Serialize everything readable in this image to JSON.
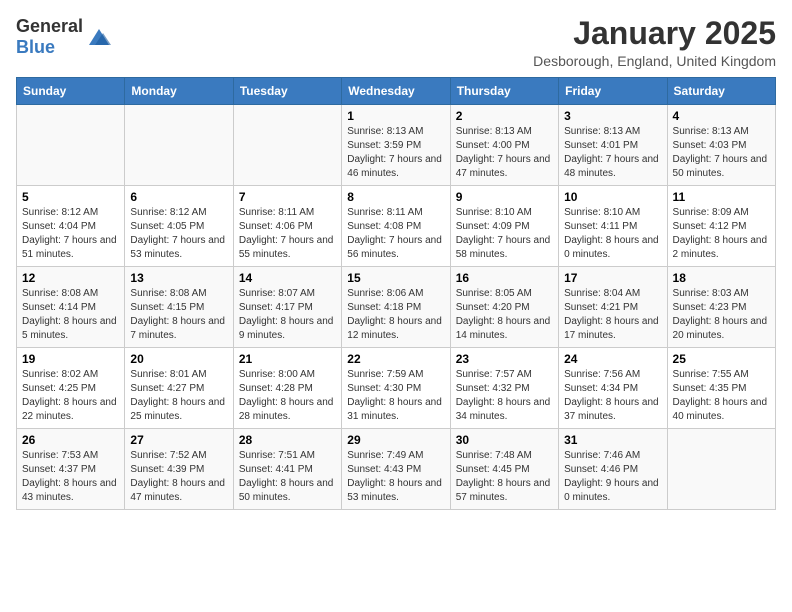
{
  "header": {
    "logo_general": "General",
    "logo_blue": "Blue",
    "title": "January 2025",
    "subtitle": "Desborough, England, United Kingdom"
  },
  "days_of_week": [
    "Sunday",
    "Monday",
    "Tuesday",
    "Wednesday",
    "Thursday",
    "Friday",
    "Saturday"
  ],
  "weeks": [
    [
      {
        "day": "",
        "sunrise": "",
        "sunset": "",
        "daylight": ""
      },
      {
        "day": "",
        "sunrise": "",
        "sunset": "",
        "daylight": ""
      },
      {
        "day": "",
        "sunrise": "",
        "sunset": "",
        "daylight": ""
      },
      {
        "day": "1",
        "sunrise": "Sunrise: 8:13 AM",
        "sunset": "Sunset: 3:59 PM",
        "daylight": "Daylight: 7 hours and 46 minutes."
      },
      {
        "day": "2",
        "sunrise": "Sunrise: 8:13 AM",
        "sunset": "Sunset: 4:00 PM",
        "daylight": "Daylight: 7 hours and 47 minutes."
      },
      {
        "day": "3",
        "sunrise": "Sunrise: 8:13 AM",
        "sunset": "Sunset: 4:01 PM",
        "daylight": "Daylight: 7 hours and 48 minutes."
      },
      {
        "day": "4",
        "sunrise": "Sunrise: 8:13 AM",
        "sunset": "Sunset: 4:03 PM",
        "daylight": "Daylight: 7 hours and 50 minutes."
      }
    ],
    [
      {
        "day": "5",
        "sunrise": "Sunrise: 8:12 AM",
        "sunset": "Sunset: 4:04 PM",
        "daylight": "Daylight: 7 hours and 51 minutes."
      },
      {
        "day": "6",
        "sunrise": "Sunrise: 8:12 AM",
        "sunset": "Sunset: 4:05 PM",
        "daylight": "Daylight: 7 hours and 53 minutes."
      },
      {
        "day": "7",
        "sunrise": "Sunrise: 8:11 AM",
        "sunset": "Sunset: 4:06 PM",
        "daylight": "Daylight: 7 hours and 55 minutes."
      },
      {
        "day": "8",
        "sunrise": "Sunrise: 8:11 AM",
        "sunset": "Sunset: 4:08 PM",
        "daylight": "Daylight: 7 hours and 56 minutes."
      },
      {
        "day": "9",
        "sunrise": "Sunrise: 8:10 AM",
        "sunset": "Sunset: 4:09 PM",
        "daylight": "Daylight: 7 hours and 58 minutes."
      },
      {
        "day": "10",
        "sunrise": "Sunrise: 8:10 AM",
        "sunset": "Sunset: 4:11 PM",
        "daylight": "Daylight: 8 hours and 0 minutes."
      },
      {
        "day": "11",
        "sunrise": "Sunrise: 8:09 AM",
        "sunset": "Sunset: 4:12 PM",
        "daylight": "Daylight: 8 hours and 2 minutes."
      }
    ],
    [
      {
        "day": "12",
        "sunrise": "Sunrise: 8:08 AM",
        "sunset": "Sunset: 4:14 PM",
        "daylight": "Daylight: 8 hours and 5 minutes."
      },
      {
        "day": "13",
        "sunrise": "Sunrise: 8:08 AM",
        "sunset": "Sunset: 4:15 PM",
        "daylight": "Daylight: 8 hours and 7 minutes."
      },
      {
        "day": "14",
        "sunrise": "Sunrise: 8:07 AM",
        "sunset": "Sunset: 4:17 PM",
        "daylight": "Daylight: 8 hours and 9 minutes."
      },
      {
        "day": "15",
        "sunrise": "Sunrise: 8:06 AM",
        "sunset": "Sunset: 4:18 PM",
        "daylight": "Daylight: 8 hours and 12 minutes."
      },
      {
        "day": "16",
        "sunrise": "Sunrise: 8:05 AM",
        "sunset": "Sunset: 4:20 PM",
        "daylight": "Daylight: 8 hours and 14 minutes."
      },
      {
        "day": "17",
        "sunrise": "Sunrise: 8:04 AM",
        "sunset": "Sunset: 4:21 PM",
        "daylight": "Daylight: 8 hours and 17 minutes."
      },
      {
        "day": "18",
        "sunrise": "Sunrise: 8:03 AM",
        "sunset": "Sunset: 4:23 PM",
        "daylight": "Daylight: 8 hours and 20 minutes."
      }
    ],
    [
      {
        "day": "19",
        "sunrise": "Sunrise: 8:02 AM",
        "sunset": "Sunset: 4:25 PM",
        "daylight": "Daylight: 8 hours and 22 minutes."
      },
      {
        "day": "20",
        "sunrise": "Sunrise: 8:01 AM",
        "sunset": "Sunset: 4:27 PM",
        "daylight": "Daylight: 8 hours and 25 minutes."
      },
      {
        "day": "21",
        "sunrise": "Sunrise: 8:00 AM",
        "sunset": "Sunset: 4:28 PM",
        "daylight": "Daylight: 8 hours and 28 minutes."
      },
      {
        "day": "22",
        "sunrise": "Sunrise: 7:59 AM",
        "sunset": "Sunset: 4:30 PM",
        "daylight": "Daylight: 8 hours and 31 minutes."
      },
      {
        "day": "23",
        "sunrise": "Sunrise: 7:57 AM",
        "sunset": "Sunset: 4:32 PM",
        "daylight": "Daylight: 8 hours and 34 minutes."
      },
      {
        "day": "24",
        "sunrise": "Sunrise: 7:56 AM",
        "sunset": "Sunset: 4:34 PM",
        "daylight": "Daylight: 8 hours and 37 minutes."
      },
      {
        "day": "25",
        "sunrise": "Sunrise: 7:55 AM",
        "sunset": "Sunset: 4:35 PM",
        "daylight": "Daylight: 8 hours and 40 minutes."
      }
    ],
    [
      {
        "day": "26",
        "sunrise": "Sunrise: 7:53 AM",
        "sunset": "Sunset: 4:37 PM",
        "daylight": "Daylight: 8 hours and 43 minutes."
      },
      {
        "day": "27",
        "sunrise": "Sunrise: 7:52 AM",
        "sunset": "Sunset: 4:39 PM",
        "daylight": "Daylight: 8 hours and 47 minutes."
      },
      {
        "day": "28",
        "sunrise": "Sunrise: 7:51 AM",
        "sunset": "Sunset: 4:41 PM",
        "daylight": "Daylight: 8 hours and 50 minutes."
      },
      {
        "day": "29",
        "sunrise": "Sunrise: 7:49 AM",
        "sunset": "Sunset: 4:43 PM",
        "daylight": "Daylight: 8 hours and 53 minutes."
      },
      {
        "day": "30",
        "sunrise": "Sunrise: 7:48 AM",
        "sunset": "Sunset: 4:45 PM",
        "daylight": "Daylight: 8 hours and 57 minutes."
      },
      {
        "day": "31",
        "sunrise": "Sunrise: 7:46 AM",
        "sunset": "Sunset: 4:46 PM",
        "daylight": "Daylight: 9 hours and 0 minutes."
      },
      {
        "day": "",
        "sunrise": "",
        "sunset": "",
        "daylight": ""
      }
    ]
  ]
}
